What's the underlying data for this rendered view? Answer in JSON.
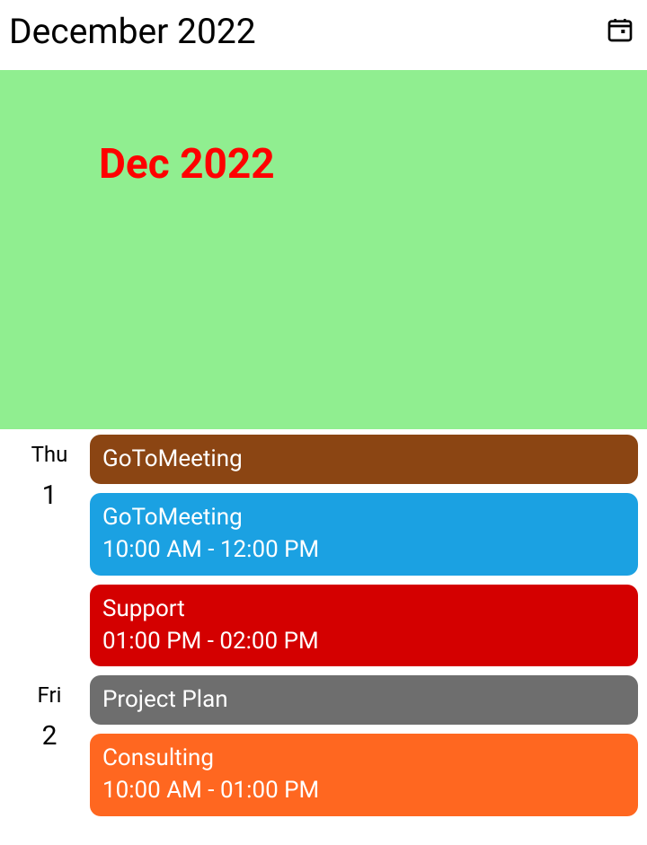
{
  "header": {
    "title": "December 2022"
  },
  "banner": {
    "label": "Dec 2022",
    "bg": "#90ee90",
    "color": "#ff0000"
  },
  "days": [
    {
      "name": "Thu",
      "number": "1",
      "events": [
        {
          "title": "GoToMeeting",
          "time": "",
          "bg": "#8b4513"
        },
        {
          "title": "GoToMeeting",
          "time": "10:00 AM - 12:00 PM",
          "bg": "#1ba1e2"
        },
        {
          "title": "Support",
          "time": "01:00 PM - 02:00 PM",
          "bg": "#d40000"
        }
      ]
    },
    {
      "name": "Fri",
      "number": "2",
      "events": [
        {
          "title": "Project Plan",
          "time": "",
          "bg": "#6e6e6e"
        },
        {
          "title": "Consulting",
          "time": "10:00 AM - 01:00 PM",
          "bg": "#ff6720"
        }
      ]
    }
  ]
}
